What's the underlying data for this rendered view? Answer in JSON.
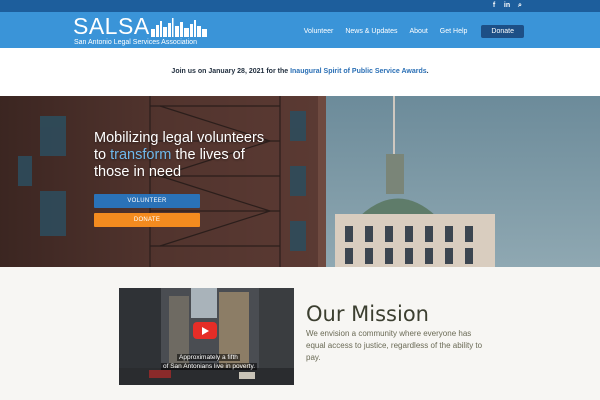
{
  "topbar": {
    "social_icons": [
      {
        "icon": "facebook-icon",
        "glyph": "f"
      },
      {
        "icon": "linkedin-icon",
        "glyph": "in"
      },
      {
        "icon": "search-icon",
        "glyph": "⌕"
      }
    ]
  },
  "header": {
    "logo_text": "SALSA",
    "logo_subtitle": "San Antonio Legal Services Association",
    "nav": [
      {
        "label": "Volunteer"
      },
      {
        "label": "News & Updates"
      },
      {
        "label": "About"
      },
      {
        "label": "Get Help"
      }
    ],
    "donate_label": "Donate"
  },
  "announcement": {
    "prefix": "Join us on January 28, 2021 for the ",
    "link": "Inaugural Spirit of Public Service Awards",
    "suffix": "."
  },
  "hero": {
    "line_a": "Mobilizing legal volunteers",
    "line_b_pre": "to ",
    "line_b_highlight": "transform",
    "line_b_post": " the lives of",
    "line_c": "those in need",
    "volunteer_button": "VOLUNTEER",
    "donate_button": "DONATE"
  },
  "mission": {
    "video_caption_1": "Approximately a fifth",
    "video_caption_2": "of San Antonians live in poverty.",
    "title": "Our Mission",
    "body": "We envision a community where everyone has equal access to justice, regardless of the ability to pay."
  },
  "colors": {
    "topbar": "#1d5e9c",
    "header": "#3a94d8",
    "accent_blue": "#2a72b8",
    "accent_orange": "#f38b1f",
    "highlight": "#6fb8ec"
  }
}
